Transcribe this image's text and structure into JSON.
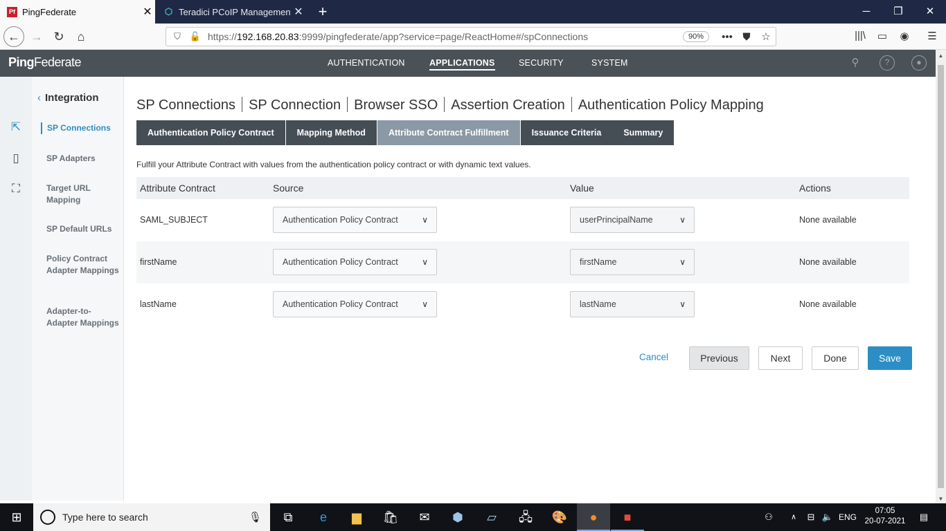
{
  "browser": {
    "tabs": [
      {
        "title": "PingFederate",
        "favicon": "Pf",
        "active": true
      },
      {
        "title": "Teradici PCoIP Management Co",
        "favicon": "teradici-icon",
        "active": false
      }
    ],
    "new_tab": "+",
    "window_controls": {
      "minimize": "─",
      "restore": "❐",
      "close": "✕"
    },
    "url_prefix": "https://",
    "url_host": "192.168.20.83",
    "url_rest": ":9999/pingfederate/app?service=page/ReactHome#/spConnections",
    "zoom": "90%"
  },
  "app": {
    "logo_part1": "Ping",
    "logo_part2": "Federate",
    "nav": [
      {
        "label": "AUTHENTICATION",
        "active": false
      },
      {
        "label": "APPLICATIONS",
        "active": true
      },
      {
        "label": "SECURITY",
        "active": false
      },
      {
        "label": "SYSTEM",
        "active": false
      }
    ],
    "help_icon": "?",
    "sidebar": {
      "heading": "Integration",
      "items": [
        {
          "label": "SP Connections",
          "active": true
        },
        {
          "label": "SP Adapters"
        },
        {
          "label": "Target URL Mapping"
        },
        {
          "label": "SP Default URLs"
        },
        {
          "label": "Policy Contract Adapter Mappings"
        },
        {
          "label": "Adapter-to-Adapter Mappings"
        }
      ]
    },
    "breadcrumb": [
      "SP Connections",
      "SP Connection",
      "Browser SSO",
      "Assertion Creation",
      "Authentication Policy Mapping"
    ],
    "wizard_tabs": [
      {
        "label": "Authentication Policy Contract",
        "active": false
      },
      {
        "label": "Mapping Method",
        "active": false
      },
      {
        "label": "Attribute Contract Fulfillment",
        "active": true
      },
      {
        "label": "Issuance Criteria",
        "active": false
      },
      {
        "label": "Summary",
        "active": false
      }
    ],
    "description": "Fulfill your Attribute Contract with values from the authentication policy contract or with dynamic text values.",
    "table": {
      "headers": [
        "Attribute Contract",
        "Source",
        "Value",
        "Actions"
      ],
      "rows": [
        {
          "attribute": "SAML_SUBJECT",
          "source": "Authentication Policy Contract",
          "value": "userPrincipalName",
          "actions": "None available"
        },
        {
          "attribute": "firstName",
          "source": "Authentication Policy Contract",
          "value": "firstName",
          "actions": "None available"
        },
        {
          "attribute": "lastName",
          "source": "Authentication Policy Contract",
          "value": "lastName",
          "actions": "None available"
        }
      ]
    },
    "buttons": {
      "cancel": "Cancel",
      "previous": "Previous",
      "next": "Next",
      "done": "Done",
      "save": "Save"
    },
    "colors": {
      "accent": "#2c8ec4",
      "header": "#4a5157",
      "tab_dark": "#454d55",
      "tab_active": "#8b98a5"
    }
  },
  "taskbar": {
    "search_placeholder": "Type here to search",
    "language": "ENG",
    "time": "07:05",
    "date": "20-07-2021"
  }
}
